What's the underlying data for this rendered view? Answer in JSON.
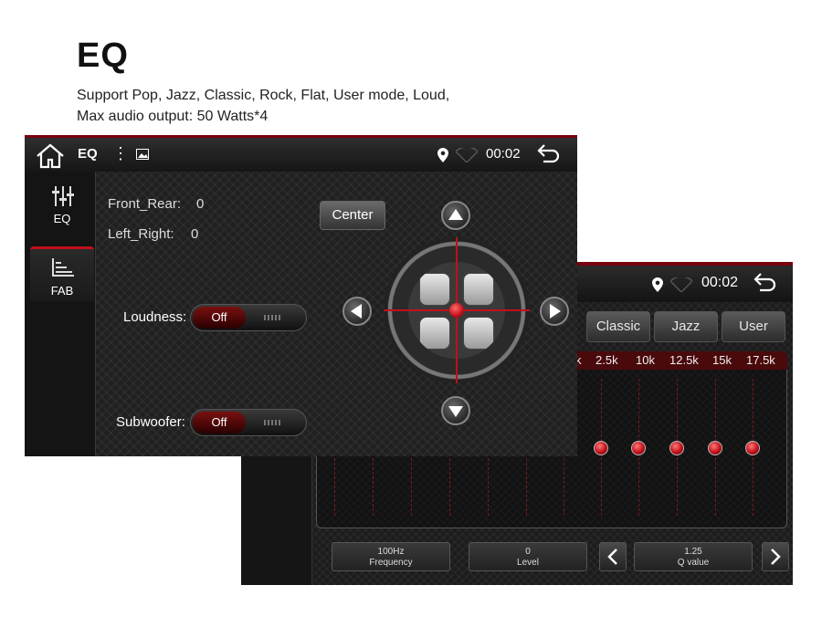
{
  "header": {
    "title": "EQ",
    "line1": "Support Pop, Jazz, Classic, Rock, Flat, User mode,  Loud,",
    "line2": "Max audio output: 50 Watts*4"
  },
  "back_screen": {
    "status": {
      "time": "00:02",
      "icons": [
        "location-pin-icon",
        "wifi-icon",
        "back-arrow-icon"
      ]
    },
    "modes": [
      "Classic",
      "Jazz",
      "User"
    ],
    "frequencies": [
      "2.5k",
      "10k",
      "12.5k",
      "15k",
      "17.5k"
    ],
    "frequency_partial": "k",
    "params": {
      "frequency_value": "100Hz",
      "frequency_label": "Frequency",
      "level_value": "0",
      "level_label": "Level",
      "q_value": "1.25",
      "q_label": "Q value"
    },
    "accent": "#c2101a"
  },
  "front_screen": {
    "status": {
      "title": "EQ",
      "time": "00:02",
      "icons": [
        "home-icon",
        "more-icon",
        "image-icon",
        "location-pin-icon",
        "wifi-icon",
        "back-arrow-icon"
      ]
    },
    "sidebar": [
      {
        "label": "EQ",
        "icon": "eq-sliders-icon"
      },
      {
        "label": "FAB",
        "icon": "fab-bars-icon"
      }
    ],
    "front_rear_label": "Front_Rear:",
    "front_rear_value": "0",
    "left_right_label": "Left_Right:",
    "left_right_value": "0",
    "loudness_label": "Loudness:",
    "loudness_state": "Off",
    "subwoofer_label": "Subwoofer:",
    "subwoofer_state": "Off",
    "center_label": "Center",
    "accent": "#c2101a"
  }
}
